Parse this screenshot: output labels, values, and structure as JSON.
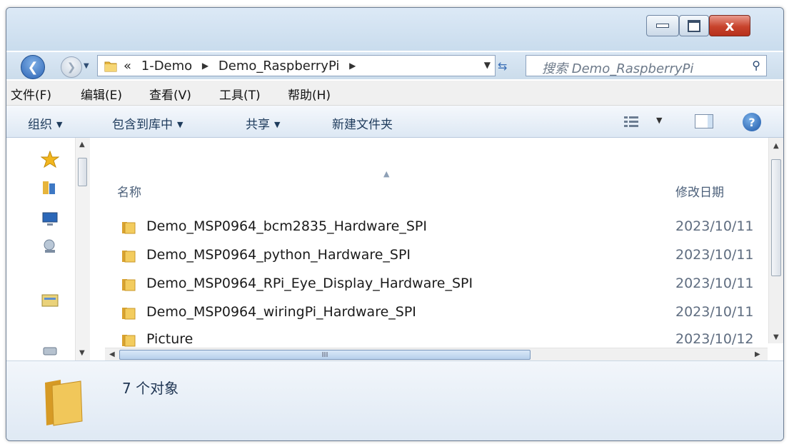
{
  "window": {
    "caption_buttons": {
      "minimize": "minimize",
      "maximize": "maximize",
      "close": "x"
    }
  },
  "nav": {
    "recent_icon": "chevron-down-icon",
    "breadcrumb_overflow": "«",
    "breadcrumbs": [
      "1-Demo",
      "Demo_RaspberryPi"
    ],
    "separator": "▶",
    "search_placeholder": "搜索 Demo_RaspberryPi"
  },
  "menubar": [
    "文件(F)",
    "编辑(E)",
    "查看(V)",
    "工具(T)",
    "帮助(H)"
  ],
  "commands": [
    "组织",
    "包含到库中",
    "共享",
    "新建文件夹"
  ],
  "columns": {
    "name": "名称",
    "date_modified": "修改日期"
  },
  "files": [
    {
      "name": "Demo_MSP0964_bcm2835_Hardware_SPI",
      "date": "2023/10/11"
    },
    {
      "name": "Demo_MSP0964_python_Hardware_SPI",
      "date": "2023/10/11"
    },
    {
      "name": "Demo_MSP0964_RPi_Eye_Display_Hardware_SPI",
      "date": "2023/10/11"
    },
    {
      "name": "Demo_MSP0964_wiringPi_Hardware_SPI",
      "date": "2023/10/11"
    },
    {
      "name": "Picture",
      "date": "2023/10/12"
    }
  ],
  "status": {
    "item_count": "7 个对象"
  },
  "colors": {
    "folder": "#f0c24b",
    "accent": "#2c64b5",
    "close": "#c8432c"
  }
}
